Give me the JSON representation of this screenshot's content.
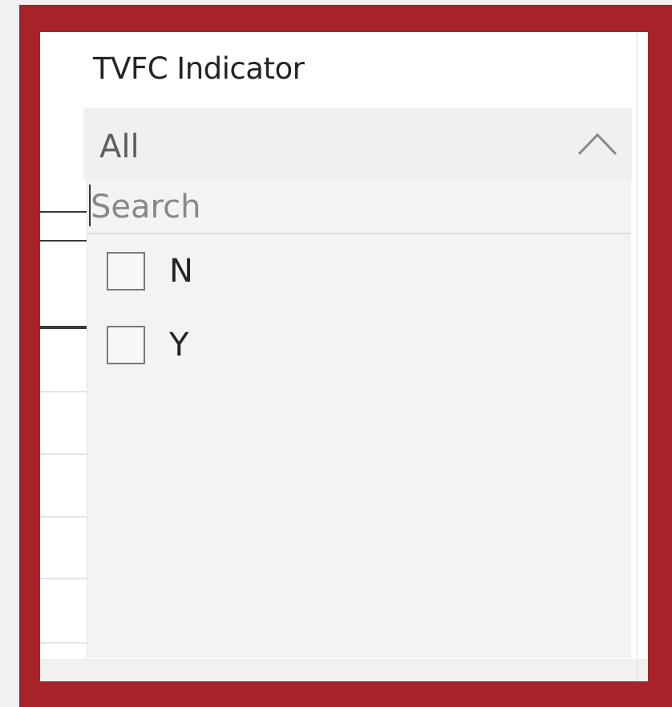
{
  "slicer": {
    "title": "TVFC Indicator",
    "selected_value": "All",
    "search_placeholder": "Search",
    "options": [
      {
        "label": "N",
        "checked": false
      },
      {
        "label": "Y",
        "checked": false
      }
    ],
    "expanded": true
  },
  "colors": {
    "focus_border": "#a8222a",
    "dropdown_bg": "#f3f3f3",
    "text": "#252423"
  },
  "icons": {
    "expand": "chevron-up-icon"
  }
}
